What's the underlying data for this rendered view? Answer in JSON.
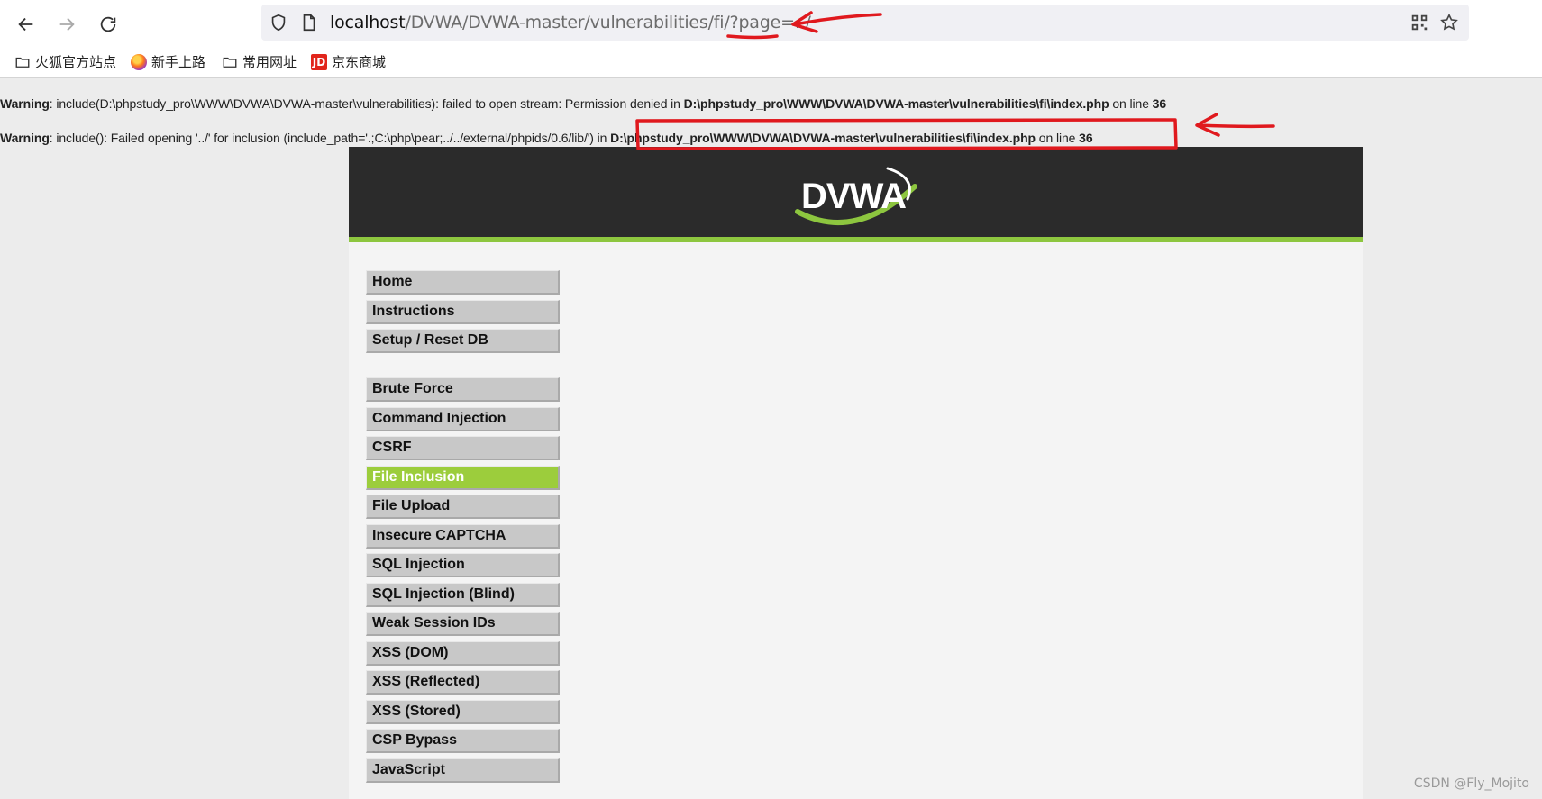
{
  "browser": {
    "url_host": "localhost",
    "url_path": "/DVWA/DVWA-master/vulnerabilities/fi/?page=../",
    "bookmarks": [
      {
        "label": "火狐官方站点",
        "icon": "folder-icon"
      },
      {
        "label": "新手上路",
        "icon": "firefox-icon"
      },
      {
        "label": "常用网址",
        "icon": "folder-icon"
      },
      {
        "label": "京东商城",
        "icon": "jd-icon",
        "icon_text": "JD"
      }
    ]
  },
  "warnings": [
    {
      "label": "Warning",
      "message": ": include(D:\\phpstudy_pro\\WWW\\DVWA\\DVWA-master\\vulnerabilities): failed to open stream: Permission denied in ",
      "file": "D:\\phpstudy_pro\\WWW\\DVWA\\DVWA-master\\vulnerabilities\\fi\\index.php",
      "line_text": " on line ",
      "line": "36"
    },
    {
      "label": "Warning",
      "message": ": include(): Failed opening '../' for inclusion (include_path='.;C:\\php\\pear;../../external/phpids/0.6/lib/') in ",
      "file": "D:\\phpstudy_pro\\WWW\\DVWA\\DVWA-master\\vulnerabilities\\fi\\index.php",
      "line_text": " on line ",
      "line": "36"
    }
  ],
  "dvwa": {
    "logo_text": "DVWA",
    "menu_group1": [
      "Home",
      "Instructions",
      "Setup / Reset DB"
    ],
    "menu_group2": [
      "Brute Force",
      "Command Injection",
      "CSRF",
      "File Inclusion",
      "File Upload",
      "Insecure CAPTCHA",
      "SQL Injection",
      "SQL Injection (Blind)",
      "Weak Session IDs",
      "XSS (DOM)",
      "XSS (Reflected)",
      "XSS (Stored)",
      "CSP Bypass",
      "JavaScript"
    ],
    "active_item": "File Inclusion"
  },
  "colors": {
    "accent_green": "#9ccd3c",
    "header_dark": "#2b2b2b",
    "annotation_red": "#e0191e"
  },
  "watermark": "CSDN @Fly_Mojito"
}
